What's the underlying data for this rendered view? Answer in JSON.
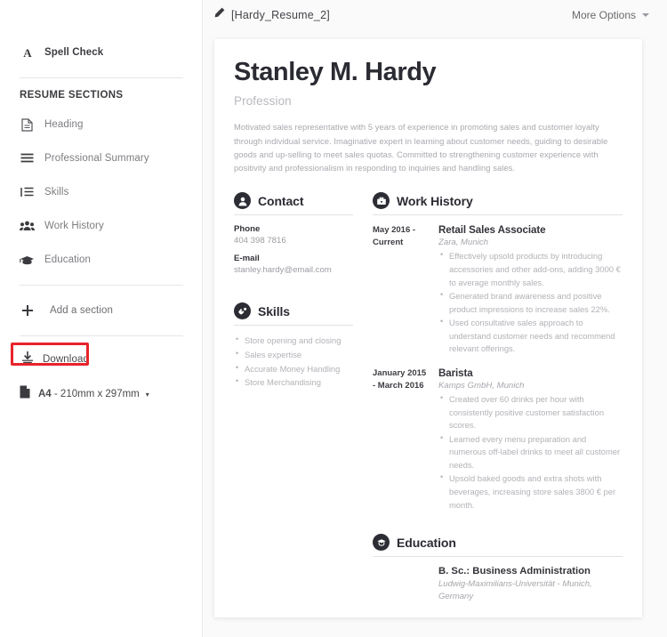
{
  "sidebar": {
    "spell_check": {
      "label": "Spell Check",
      "icon": "letter-a-icon"
    },
    "sections_title": "RESUME SECTIONS",
    "items": [
      {
        "label": "Heading",
        "icon": "document-icon"
      },
      {
        "label": "Professional Summary",
        "icon": "lines-icon"
      },
      {
        "label": "Skills",
        "icon": "list-icon"
      },
      {
        "label": "Work History",
        "icon": "people-icon"
      },
      {
        "label": "Education",
        "icon": "graduation-cap-icon"
      }
    ],
    "add_section": {
      "label": "Add a section",
      "icon": "plus-icon"
    },
    "download": {
      "label": "Download",
      "icon": "download-icon",
      "highlight_color": "#e8232a"
    },
    "paper_size": {
      "label_bold": "A4",
      "label_rest": " - 210mm x 297mm",
      "icon": "page-icon",
      "caret": "▾"
    }
  },
  "topbar": {
    "document_title": "[Hardy_Resume_2]",
    "edit_icon": "pencil-icon",
    "more_options": "More Options"
  },
  "resume": {
    "name": "Stanley M. Hardy",
    "profession_placeholder": "Profession",
    "summary": "Motivated sales representative with 5 years of experience in promoting sales and customer loyalty through individual service. Imaginative expert in learning about customer needs, guiding to desirable goods and up-selling to meet sales quotas. Committed to strengthening customer experience with positivity and professionalism in responding to inquiries and handling sales.",
    "contact": {
      "title": "Contact",
      "icon": "person-circle-icon",
      "phone_label": "Phone",
      "phone_value": "404 398 7816",
      "email_label": "E-mail",
      "email_value": "stanley.hardy@email.com"
    },
    "skills": {
      "title": "Skills",
      "icon": "skills-circle-icon",
      "items": [
        "Store opening and closing",
        "Sales expertise",
        "Accurate Money Handling",
        "Store Merchandising"
      ]
    },
    "work_history": {
      "title": "Work History",
      "icon": "briefcase-circle-icon",
      "jobs": [
        {
          "dates": "May 2016 - Current",
          "title": "Retail Sales Associate",
          "org": "Zara, Munich",
          "bullets": [
            "Effectively upsold products by introducing accessories and other add-ons, adding 3000 € to average monthly sales.",
            "Generated brand awareness and positive product impressions to increase sales 22%.",
            "Used consultative sales approach to understand customer needs and recommend relevant offerings."
          ]
        },
        {
          "dates": "January 2015 - March 2016",
          "title": "Barista",
          "org": "Kamps GmbH, Munich",
          "bullets": [
            "Created over 60 drinks per hour with consistently positive customer satisfaction scores.",
            "Learned every menu preparation and numerous off-label drinks to meet all customer needs.",
            "Upsold baked goods and extra shots with beverages, increasing store sales 3800 € per month."
          ]
        }
      ]
    },
    "education": {
      "title": "Education",
      "icon": "graduation-circle-icon",
      "degree": "B. Sc.: Business Administration",
      "school": "Ludwig-Maximilians-Universität - Munich, Germany"
    }
  }
}
